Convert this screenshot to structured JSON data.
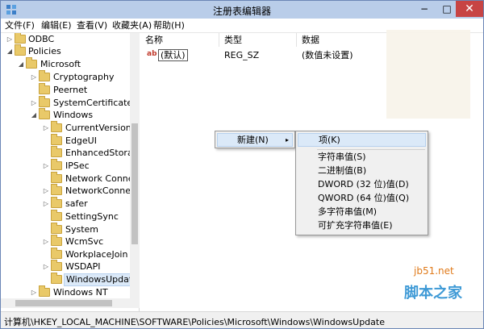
{
  "titlebar": {
    "title": "注册表编辑器",
    "minimize": "−",
    "maximize": "□",
    "close": "✕"
  },
  "menubar": {
    "items": [
      "文件(F)",
      "编辑(E)",
      "查看(V)",
      "收藏夹(A)",
      "帮助(H)"
    ]
  },
  "tree": {
    "items": [
      {
        "label": "ODBC",
        "arrow": "▷"
      },
      {
        "label": "Policies",
        "arrow": "◢"
      },
      {
        "label": "Microsoft",
        "arrow": "◢"
      },
      {
        "label": "Cryptography",
        "arrow": "▷"
      },
      {
        "label": "Peernet",
        "arrow": ""
      },
      {
        "label": "SystemCertificates",
        "arrow": "▷"
      },
      {
        "label": "Windows",
        "arrow": "◢"
      },
      {
        "label": "CurrentVersion",
        "arrow": "▷"
      },
      {
        "label": "EdgeUI",
        "arrow": ""
      },
      {
        "label": "EnhancedStorage",
        "arrow": ""
      },
      {
        "label": "IPSec",
        "arrow": "▷"
      },
      {
        "label": "Network Connect",
        "arrow": ""
      },
      {
        "label": "NetworkConnecti",
        "arrow": "▷"
      },
      {
        "label": "safer",
        "arrow": "▷"
      },
      {
        "label": "SettingSync",
        "arrow": ""
      },
      {
        "label": "System",
        "arrow": ""
      },
      {
        "label": "WcmSvc",
        "arrow": "▷"
      },
      {
        "label": "WorkplaceJoin",
        "arrow": ""
      },
      {
        "label": "WSDAPI",
        "arrow": "▷"
      },
      {
        "label": "WindowsUpdate",
        "arrow": ""
      },
      {
        "label": "Windows NT",
        "arrow": "▷"
      }
    ]
  },
  "list": {
    "columns": [
      "名称",
      "类型",
      "数据"
    ],
    "rows": [
      {
        "icon": "ab",
        "name": "(默认)",
        "type": "REG_SZ",
        "data": "(数值未设置)"
      }
    ]
  },
  "context_menu": {
    "new_label": "新建(N)",
    "submenu_arrow": "▸",
    "items": [
      "项(K)",
      "字符串值(S)",
      "二进制值(B)",
      "DWORD (32 位)值(D)",
      "QWORD (64 位)值(Q)",
      "多字符串值(M)",
      "可扩充字符串值(E)"
    ]
  },
  "statusbar": {
    "path": "计算机\\HKEY_LOCAL_MACHINE\\SOFTWARE\\Policies\\Microsoft\\Windows\\WindowsUpdate"
  },
  "watermark": {
    "site": "jb51.net",
    "name": "脚本之家"
  }
}
